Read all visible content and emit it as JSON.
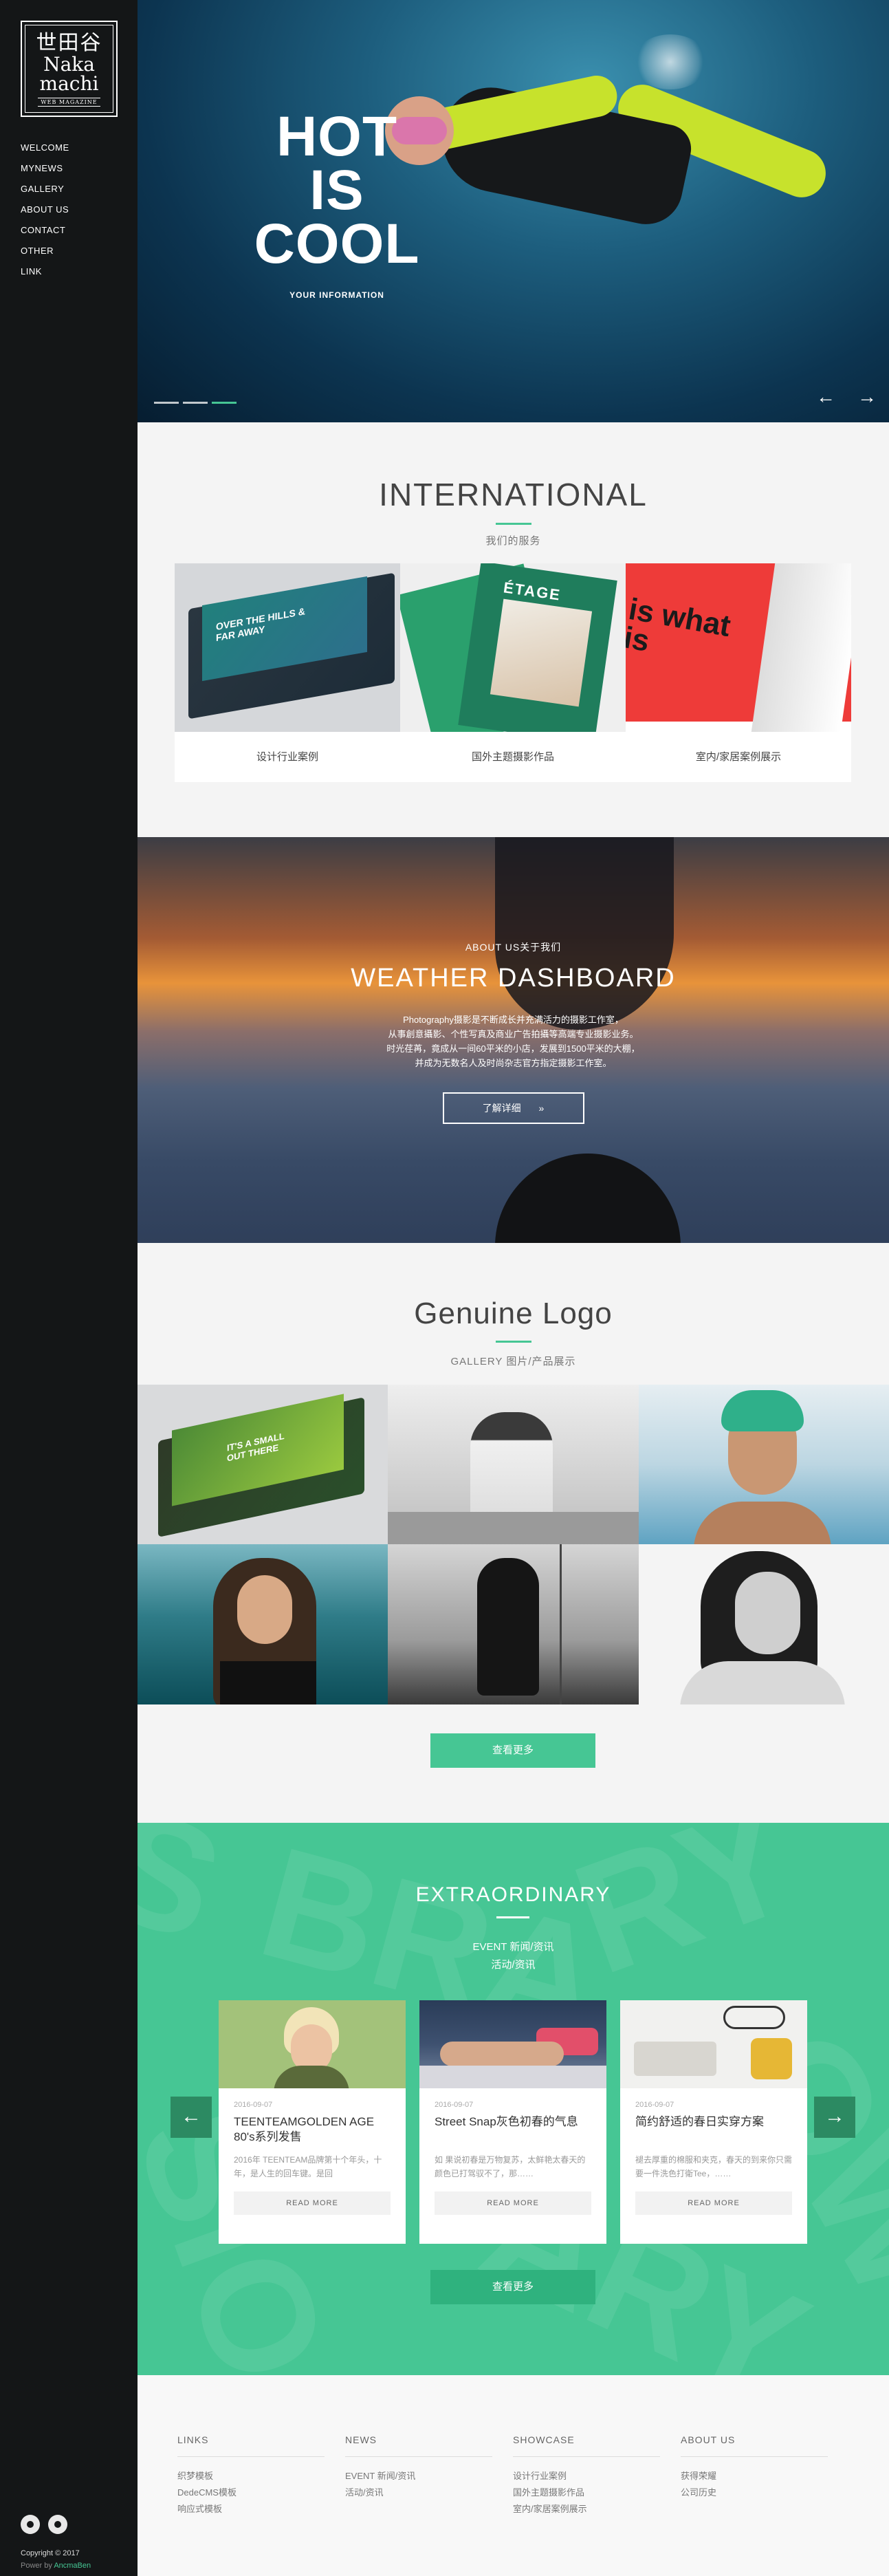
{
  "logo": {
    "cn": "世田谷",
    "en_line1": "Naka",
    "en_line2": "machi",
    "sub": "WEB MAGAZINE"
  },
  "nav": [
    "WELCOME",
    "MYNEWS",
    "GALLERY",
    "ABOUT US",
    "CONTACT",
    "OTHER",
    "LINK"
  ],
  "sidebar": {
    "copyright": "Copyright © 2017",
    "powered_prefix": "Power by",
    "powered_by": "AncmaBen"
  },
  "hero": {
    "title_line1": "HOT",
    "title_line2": "IS",
    "title_line3": "COOL",
    "subtitle": "YOUR INFORMATION",
    "prev": "←",
    "next": "→",
    "active_slide": 3,
    "slides": 3
  },
  "international": {
    "title": "INTERNATIONAL",
    "subtitle": "我们的服务",
    "cards": [
      {
        "label": "设计行业案例",
        "art": "OVER THE HILLS & FAR AWAY"
      },
      {
        "label": "国外主题摄影作品",
        "art": "ÉTAGE"
      },
      {
        "label": "室内/家居案例展示",
        "art": "is what is"
      }
    ]
  },
  "weather": {
    "kicker": "ABOUT US关于我们",
    "title": "WEATHER DASHBOARD",
    "desc_lines": [
      "Photography摄影是不断成长并充满活力的摄影工作室，",
      "从事創意攝影、个性写真及商业广告拍攝等高端专业摄影业务。",
      "时光荏苒，竟成从一间60平米的小店，发展到1500平米的大棚，",
      "并成为无数名人及时尚杂志官方指定摄影工作室。"
    ],
    "button": "了解详细",
    "button_icon": "»"
  },
  "gallery": {
    "title": "Genuine Logo",
    "subtitle": "GALLERY 图片/产品展示",
    "art": "IT'S A SMALL OUT THERE",
    "button": "查看更多"
  },
  "extraordinary": {
    "title": "EXTRAORDINARY",
    "sub_line1": "EVENT 新闻/资讯",
    "sub_line2": "活动/资讯",
    "prev": "←",
    "next": "→",
    "button": "查看更多",
    "cards": [
      {
        "date": "2016-09-07",
        "title": "TEENTEAMGOLDEN AGE 80's系列发售",
        "excerpt": "2016年 TEENTEAM品牌第十个年头，十年，是人生的回车键。是回",
        "button": "READ MORE"
      },
      {
        "date": "2016-09-07",
        "title": "Street Snap灰色初春的气息",
        "excerpt": "如 果说初春是万物复苏，太鲜艳太春天的颜色已打驾驭不了，那……",
        "button": "READ MORE"
      },
      {
        "date": "2016-09-07",
        "title": "简约舒适的春日实穿方案",
        "excerpt": "褪去厚重的棉服和夹克，春天的到来你只需要一件洗色打衛Tee，……",
        "button": "READ MORE"
      }
    ]
  },
  "footer": {
    "columns": [
      {
        "head": "LINKS",
        "links": [
          "织梦模板",
          "DedeCMS模板",
          "响应式模板"
        ]
      },
      {
        "head": "NEWS",
        "links": [
          "EVENT 新闻/资讯",
          "活动/资讯"
        ]
      },
      {
        "head": "SHOWCASE",
        "links": [
          "设计行业案例",
          "国外主题摄影作品",
          "室内/家居案例展示"
        ]
      },
      {
        "head": "ABOUT US",
        "links": [
          "获得荣耀",
          "公司历史"
        ]
      }
    ]
  },
  "colors": {
    "accent": "#46c694",
    "sidebar": "#141617",
    "section_bg": "#f4f4f4"
  }
}
